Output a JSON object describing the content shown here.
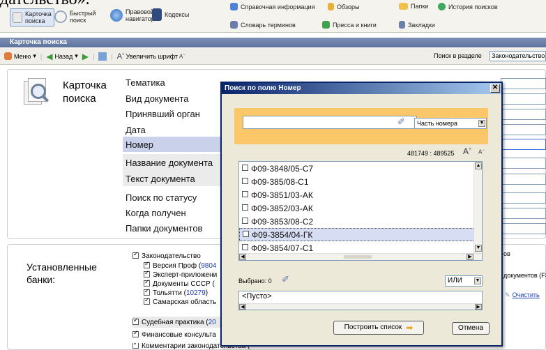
{
  "top_cut_text": "дательство».",
  "ribbon": {
    "card_search": "Карточка поиска",
    "quick_search": "Быстрый поиск",
    "legal_navigator": "Правовой навигатор",
    "codes": "Кодексы",
    "reference_info": "Справочная информация",
    "reviews": "Обзоры",
    "glossary": "Словарь терминов",
    "press_books": "Пресса и книги",
    "folders": "Папки",
    "search_history": "История поисков",
    "bookmarks": "Закладки"
  },
  "panel_title": "Карточка поиска",
  "toolbar": {
    "menu": "Меню",
    "back": "Назад",
    "enlarge_font": "Увеличить шрифт",
    "search_in_section": "Поиск в разделе",
    "section_value": "Законодательство"
  },
  "card": {
    "title": "Карточка поиска",
    "fields": [
      "Тематика",
      "Вид документа",
      "Принявший орган",
      "Дата",
      "Номер",
      "Название документа",
      "Текст документа",
      "Поиск по статусу",
      "Когда получен",
      "Папки документов"
    ]
  },
  "banks": {
    "title": "Установленные банки:",
    "items": [
      {
        "label": "Законодательство",
        "count": ""
      },
      {
        "label": "Версия Проф (",
        "count": "9804"
      },
      {
        "label": "Эксперт-приложени",
        "count": ""
      },
      {
        "label": "Документы СССР (",
        "count": ""
      },
      {
        "label": "Тольятти (",
        "count": "10279"
      },
      {
        "label": "Самарская область",
        "count": ""
      },
      {
        "label": "Судебная практика (",
        "count": "20"
      },
      {
        "label": "Финансовые консульта",
        "count": ""
      },
      {
        "label": "Комментарии законодательства (",
        "count": ""
      }
    ],
    "right_docs": "документов (FS",
    "right_clear": "Очистить",
    "right_short": "ов"
  },
  "dialog": {
    "title": "Поиск по полю Номер",
    "close": "x",
    "search_value": "",
    "mode": "Часть номера",
    "counter": "481749 : 489525",
    "items": [
      "Ф09-3848/05-С7",
      "Ф09-385/08-С1",
      "Ф09-3851/03-АК",
      "Ф09-3852/03-АК",
      "Ф09-3853/08-С2",
      "Ф09-3854/04-ГК",
      "Ф09-3854/07-С1"
    ],
    "selected_label": "Выбрано: 0",
    "logic": "ИЛИ",
    "selected_box": "<Пусто>",
    "build": "Построить список",
    "cancel": "Отмена"
  }
}
